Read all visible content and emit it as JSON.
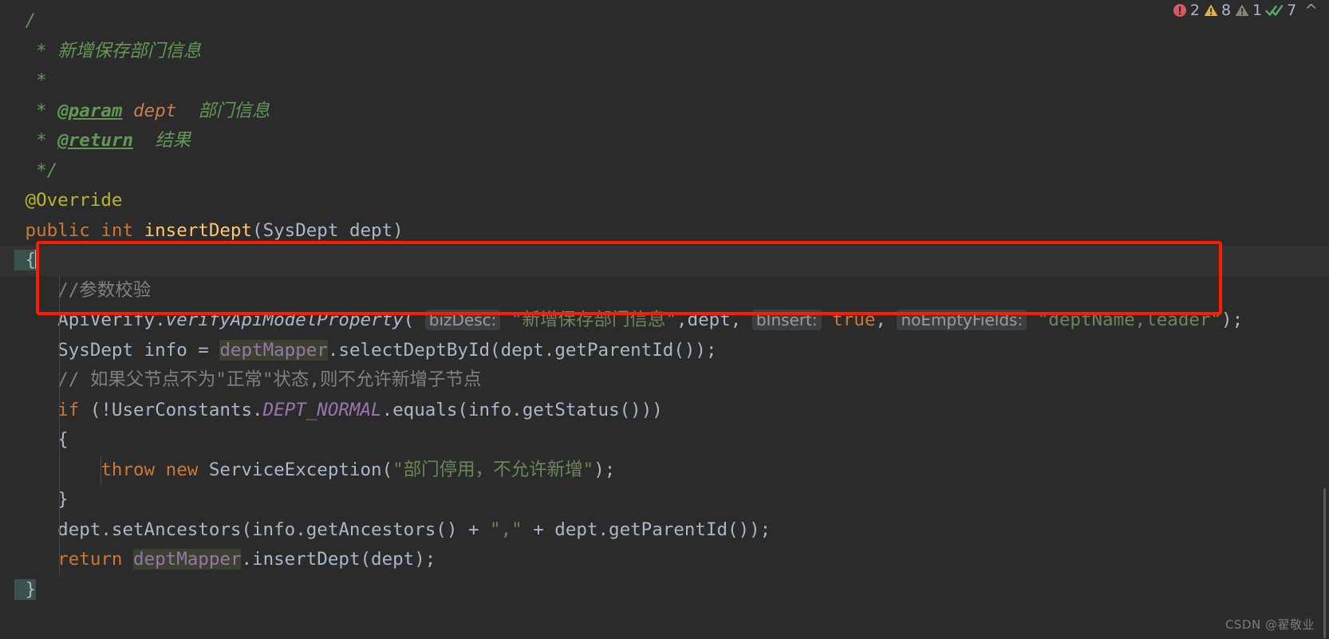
{
  "editor": {
    "background": "#2b2b2b",
    "foreground": "#a9b7c6",
    "current_line_background": "#323232"
  },
  "inspection_widget": {
    "errors": {
      "icon": "error-circle-icon",
      "count": "2",
      "color": "#db5860"
    },
    "warnings": {
      "icon": "warning-triangle-icon",
      "count": "8",
      "color": "#e3b341"
    },
    "weak_warnings": {
      "icon": "weak-warning-triangle-icon",
      "count": "1",
      "color": "#8a8472"
    },
    "checks_passed": {
      "icon": "double-check-icon",
      "count": "7",
      "color": "#59a869"
    },
    "collapse": {
      "icon": "chevron-up-icon",
      "glyph": "^"
    }
  },
  "annotation": {
    "name": "red-highlight-box",
    "color": "#ff1a00"
  },
  "watermark": {
    "text": "CSDN @翟敬业"
  },
  "code": {
    "lines": [
      {
        "id": "javadoc-open",
        "tokens": [
          {
            "cls": "cm",
            "t": " /"
          }
        ]
      },
      {
        "id": "javadoc-summary",
        "tokens": [
          {
            "cls": "cm",
            "t": "  * "
          },
          {
            "cls": "cm",
            "t": "新增保存部门信息"
          }
        ]
      },
      {
        "id": "javadoc-blank",
        "tokens": [
          {
            "cls": "cm",
            "t": "  *"
          }
        ]
      },
      {
        "id": "javadoc-param",
        "tokens": [
          {
            "cls": "cm",
            "t": "  * "
          },
          {
            "cls": "cm-tag",
            "t": "@param"
          },
          {
            "cls": "cm",
            "t": " "
          },
          {
            "cls": "cm-param",
            "t": "dept"
          },
          {
            "cls": "cm",
            "t": "  部门信息"
          }
        ]
      },
      {
        "id": "javadoc-return",
        "tokens": [
          {
            "cls": "cm",
            "t": "  * "
          },
          {
            "cls": "cm-tag",
            "t": "@return"
          },
          {
            "cls": "cm",
            "t": "  结果"
          }
        ]
      },
      {
        "id": "javadoc-close",
        "tokens": [
          {
            "cls": "cm",
            "t": "  */"
          }
        ]
      },
      {
        "id": "override-annotation",
        "tokens": [
          {
            "cls": "ann",
            "t": " @Override"
          }
        ]
      },
      {
        "id": "method-signature",
        "tokens": [
          {
            "cls": "kw",
            "t": " public "
          },
          {
            "cls": "kw",
            "t": "int "
          },
          {
            "cls": "meth",
            "t": "insertDept"
          },
          {
            "cls": "id",
            "t": "(SysDept dept)"
          }
        ]
      },
      {
        "id": "method-open-brace",
        "current": true,
        "tokens": [
          {
            "cls": "brace-hl",
            "t": " {"
          },
          {
            "cls": "caret",
            "t": ""
          }
        ]
      },
      {
        "id": "comment-param-check",
        "tokens": [
          {
            "cls": "lcm",
            "t": "    //参数校验"
          }
        ]
      },
      {
        "id": "api-verify-call",
        "tokens": [
          {
            "cls": "id",
            "t": "    ApiVerify."
          },
          {
            "cls": "italm",
            "t": "verifyApiModelProperty"
          },
          {
            "cls": "id",
            "t": "( "
          },
          {
            "cls": "hint",
            "t": "bizDesc:"
          },
          {
            "cls": "str",
            "t": " \"新增保存部门信息\""
          },
          {
            "cls": "id",
            "t": ","
          },
          {
            "cls": "id",
            "t": "dept"
          },
          {
            "cls": "id",
            "t": ", "
          },
          {
            "cls": "hint",
            "t": "bInsert:"
          },
          {
            "cls": "kw",
            "t": " true"
          },
          {
            "cls": "id",
            "t": ", "
          },
          {
            "cls": "hint",
            "t": "noEmptyFields:"
          },
          {
            "cls": "str",
            "t": " \"deptName,leader\""
          },
          {
            "cls": "id",
            "t": ");"
          }
        ]
      },
      {
        "id": "select-dept-by-id",
        "tokens": [
          {
            "cls": "id",
            "t": "    SysDept info = "
          },
          {
            "cls": "fieldhl",
            "t": "deptMapper"
          },
          {
            "cls": "id",
            "t": ".selectDeptById(dept.getParentId());"
          }
        ]
      },
      {
        "id": "comment-parent-status",
        "tokens": [
          {
            "cls": "lcm",
            "t": "    // 如果父节点不为\"正常\"状态,则不允许新增子节点"
          }
        ]
      },
      {
        "id": "if-dept-normal",
        "tokens": [
          {
            "cls": "kw",
            "t": "    if "
          },
          {
            "cls": "id",
            "t": "(!UserConstants."
          },
          {
            "cls": "stat",
            "t": "DEPT_NORMAL"
          },
          {
            "cls": "id",
            "t": ".equals(info.getStatus()))"
          }
        ]
      },
      {
        "id": "if-open-brace",
        "tokens": [
          {
            "cls": "id",
            "t": "    {"
          }
        ]
      },
      {
        "id": "throw-service-exception",
        "tokens": [
          {
            "cls": "kw",
            "t": "        throw new "
          },
          {
            "cls": "id",
            "t": "ServiceException("
          },
          {
            "cls": "str",
            "t": "\"部门停用，不允许新增\""
          },
          {
            "cls": "id",
            "t": ");"
          }
        ]
      },
      {
        "id": "if-close-brace",
        "tokens": [
          {
            "cls": "id",
            "t": "    }"
          }
        ]
      },
      {
        "id": "set-ancestors",
        "tokens": [
          {
            "cls": "id",
            "t": "    dept.setAncestors(info.getAncestors() + "
          },
          {
            "cls": "str",
            "t": "\",\""
          },
          {
            "cls": "id",
            "t": " + dept.getParentId());"
          }
        ]
      },
      {
        "id": "return-insert-dept",
        "tokens": [
          {
            "cls": "kw",
            "t": "    return "
          },
          {
            "cls": "fieldhl",
            "t": "deptMapper"
          },
          {
            "cls": "id",
            "t": ".insertDept(dept);"
          }
        ]
      },
      {
        "id": "method-close-brace",
        "tokens": [
          {
            "cls": "brace-hl",
            "t": " }"
          }
        ]
      }
    ]
  }
}
